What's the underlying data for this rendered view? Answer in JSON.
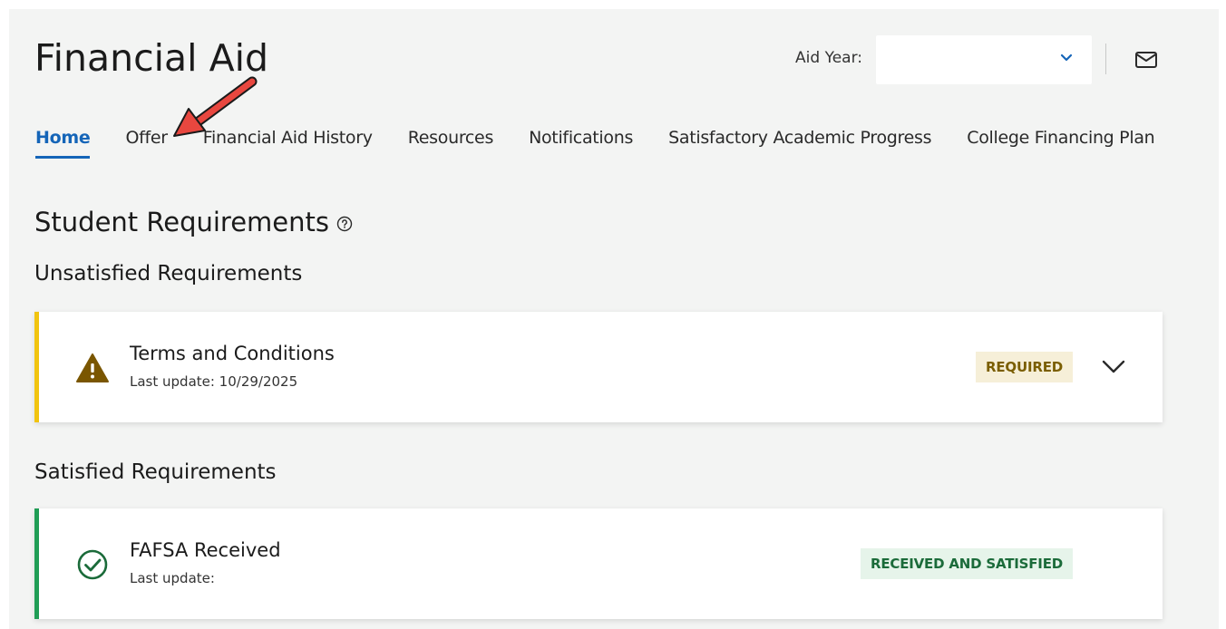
{
  "header": {
    "title": "Financial Aid",
    "aid_year_label": "Aid Year:",
    "aid_year_value": ""
  },
  "tabs": [
    {
      "label": "Home",
      "active": true
    },
    {
      "label": "Offer",
      "active": false
    },
    {
      "label": "Financial Aid History",
      "active": false
    },
    {
      "label": "Resources",
      "active": false
    },
    {
      "label": "Notifications",
      "active": false
    },
    {
      "label": "Satisfactory Academic Progress",
      "active": false
    },
    {
      "label": "College Financing Plan",
      "active": false
    }
  ],
  "requirements": {
    "title": "Student Requirements",
    "unsatisfied_title": "Unsatisfied Requirements",
    "satisfied_title": "Satisfied Requirements",
    "unsatisfied": [
      {
        "name": "Terms and Conditions",
        "update": "Last update: 10/29/2025",
        "status": "REQUIRED",
        "icon": "warning-icon"
      }
    ],
    "satisfied": [
      {
        "name": "FAFSA Received",
        "update": "Last update:",
        "status": "RECEIVED AND SATISFIED",
        "icon": "check-circle-icon"
      }
    ]
  },
  "colors": {
    "accent": "#1565b8",
    "warning": "#f1c40f",
    "success": "#1f9d55",
    "annotation_arrow": "#e8473f"
  }
}
